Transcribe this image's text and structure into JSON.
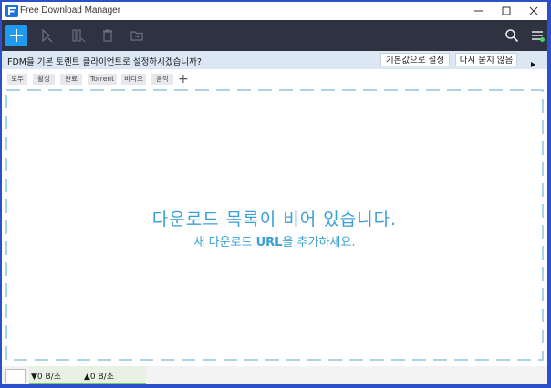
{
  "window": {
    "title": "Free Download Manager"
  },
  "notice": {
    "text": "FDM을 기본 토렌트 클라이언트로 설정하시겠습니까?",
    "set_default_label": "기본값으로 설정",
    "dont_ask_label": "다시 묻지 않음"
  },
  "filters": {
    "tabs": [
      {
        "label": "모두"
      },
      {
        "label": "활성"
      },
      {
        "label": "완료"
      },
      {
        "label": "Torrent"
      },
      {
        "label": "비디오"
      },
      {
        "label": "음악"
      }
    ],
    "add_label": "+"
  },
  "empty_state": {
    "title": "다운로드 목록이 비어 있습니다.",
    "subtitle_before": "새 다운로드 ",
    "subtitle_strong": "URL",
    "subtitle_after": "을 추가하세요."
  },
  "status": {
    "download_speed": "▼0 B/초",
    "upload_speed": "▲0 B/초"
  },
  "colors": {
    "toolbar": "#2f3241",
    "accent": "#1e9bf0",
    "empty_text": "#3aa0d4",
    "notice_bg": "#dbe8f4"
  },
  "icons": [
    "app-logo-icon",
    "minimize-icon",
    "maximize-icon",
    "close-icon",
    "plus-icon",
    "start-icon",
    "pause-icon",
    "delete-icon",
    "folder-icon",
    "search-icon",
    "menu-icon",
    "play-arrow-icon"
  ]
}
